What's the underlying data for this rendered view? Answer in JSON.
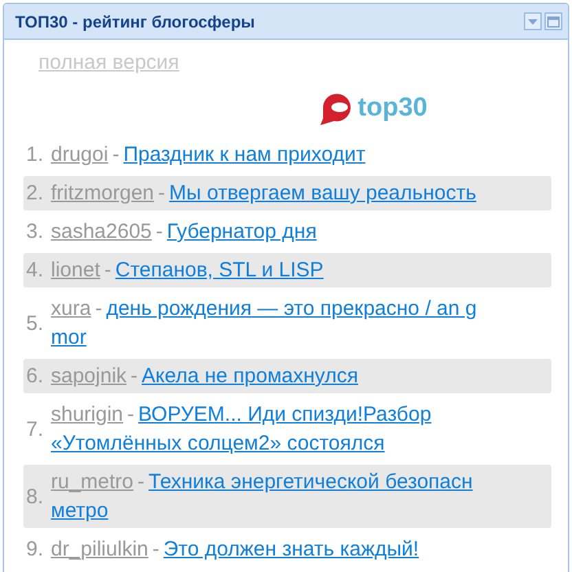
{
  "panel": {
    "title": "ТОП30 - рейтинг блогосферы"
  },
  "full_version_link": "полная версия",
  "logo": {
    "text": "top30"
  },
  "entries": [
    {
      "number": "1.",
      "author": "drugoi",
      "separator": "-",
      "title_lines": [
        "Праздник к нам приходит"
      ],
      "highlighted": false
    },
    {
      "number": "2.",
      "author": "fritzmorgen",
      "separator": "-",
      "title_lines": [
        "Мы отвергаем вашу реальность"
      ],
      "highlighted": true
    },
    {
      "number": "3.",
      "author": "sasha2605",
      "separator": "-",
      "title_lines": [
        "Губернатор дня"
      ],
      "highlighted": false
    },
    {
      "number": "4.",
      "author": "lionet",
      "separator": "-",
      "title_lines": [
        "Степанов, STL и LISP"
      ],
      "highlighted": true
    },
    {
      "number": "5.",
      "author": "xura",
      "separator": "-",
      "title_lines": [
        "день рождения — это прекрасно / an g",
        "mor"
      ],
      "highlighted": false
    },
    {
      "number": "6.",
      "author": "sapojnik",
      "separator": "-",
      "title_lines": [
        "Акела не промахнулся"
      ],
      "highlighted": true
    },
    {
      "number": "7.",
      "author": "shurigin",
      "separator": "-",
      "title_lines": [
        "ВОРУЕМ... Иди спизди!Разбор",
        "«Утомлённых солцем2» состоялся"
      ],
      "highlighted": false
    },
    {
      "number": "8.",
      "author": "ru_metro",
      "separator": "-",
      "title_lines": [
        "Техника энергетической безопасн",
        "метро"
      ],
      "highlighted": true
    },
    {
      "number": "9.",
      "author": "dr_piliulkin",
      "separator": "-",
      "title_lines": [
        "Это должен знать каждый!"
      ],
      "highlighted": false
    }
  ]
}
